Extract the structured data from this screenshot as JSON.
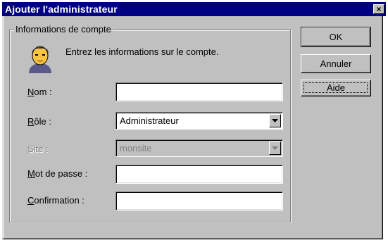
{
  "window": {
    "title": "Ajouter l'administrateur",
    "close_label": "×"
  },
  "group": {
    "legend": "Informations de compte",
    "intro": "Entrez les informations sur le compte."
  },
  "fields": {
    "nom": {
      "label_access": "N",
      "label_rest": "om :",
      "value": ""
    },
    "role": {
      "label_access": "R",
      "label_rest": "ôle :",
      "value": "Administrateur"
    },
    "site": {
      "label_access": "S",
      "label_rest": "ite :",
      "value": "monsite",
      "enabled": false
    },
    "password": {
      "label_access": "M",
      "label_rest": "ot de passe :",
      "value": ""
    },
    "confirm": {
      "label_access": "C",
      "label_rest": "onfirmation :",
      "value": ""
    }
  },
  "buttons": {
    "ok": "OK",
    "cancel": "Annuler",
    "help": "Aide"
  },
  "icons": {
    "avatar": "user-face-icon",
    "combo_arrow": "chevron-down-icon",
    "close": "close-icon"
  }
}
